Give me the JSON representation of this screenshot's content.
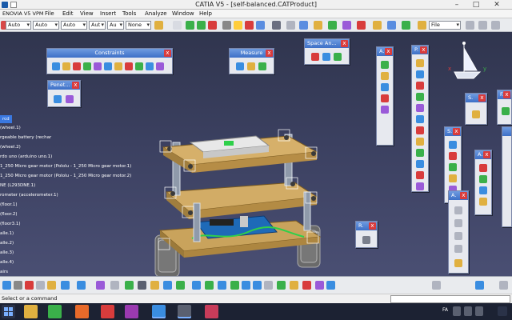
{
  "window": {
    "title": "CATIA V5 - [self-balanced.CATProduct]",
    "controls": {
      "minimize": "–",
      "maximize": "□",
      "close": "✕"
    }
  },
  "menu": {
    "items": [
      "ENOVIA V5 VPM",
      "File",
      "Edit",
      "View",
      "Insert",
      "Tools",
      "Analyze",
      "Window",
      "Help"
    ]
  },
  "toolbar": {
    "combos": [
      "Auto",
      "Auto",
      "Auto",
      "Aut",
      "Au",
      "None"
    ],
    "filter_combo": "File",
    "colors": {
      "accent": "#3d6fc7",
      "bg": "#e9ebee"
    }
  },
  "panels": {
    "constraints": {
      "title": "Constraints",
      "close": "x"
    },
    "measure": {
      "title": "Measure",
      "close": "x"
    },
    "space_analysis": {
      "title": "Space An...",
      "close": "x"
    },
    "penetration": {
      "title": "Penet...",
      "close": "x"
    },
    "p1": {
      "title": "A.",
      "close": "x"
    },
    "p2": {
      "title": "P.",
      "close": "x"
    },
    "p3": {
      "title": "S.",
      "close": "x"
    },
    "p4": {
      "title": "F.",
      "close": "x"
    },
    "p5": {
      "title": "S.",
      "close": "x"
    },
    "p6": {
      "title": "A.",
      "close": "x"
    },
    "p7": {
      "title": "A.",
      "close": "x"
    },
    "p8": {
      "title": "R.",
      "close": "x"
    }
  },
  "tree": {
    "items": [
      {
        "label": "rcd",
        "selected": true
      },
      {
        "label": "(wheel.1)"
      },
      {
        "label": "rgeable battery (rechar"
      },
      {
        "label": "(wheel.2)"
      },
      {
        "label": "rdo uno (arduino uno.1)"
      },
      {
        "label": "1_250 Micro gear motor (Pololu - 1_250 Micro gear motor.1)"
      },
      {
        "label": "1_250 Micro gear motor (Pololu - 1_250 Micro gear motor.2)"
      },
      {
        "label": "NE (L293DNE.1)"
      },
      {
        "label": "rometer (accelerometer.1)"
      },
      {
        "label": "(floor.1)"
      },
      {
        "label": "(floor.2)"
      },
      {
        "label": "(floor3.1)"
      },
      {
        "label": "alle.1)"
      },
      {
        "label": "alle.2)"
      },
      {
        "label": "alle.3)"
      },
      {
        "label": "alle.4)"
      },
      {
        "label": "airs"
      },
      {
        "label": "s"
      }
    ]
  },
  "compass": {
    "axis_x": "x",
    "axis_y": "y"
  },
  "status": {
    "text": "Select or a command"
  },
  "taskbar": {
    "tray": {
      "lang": "FA"
    }
  }
}
